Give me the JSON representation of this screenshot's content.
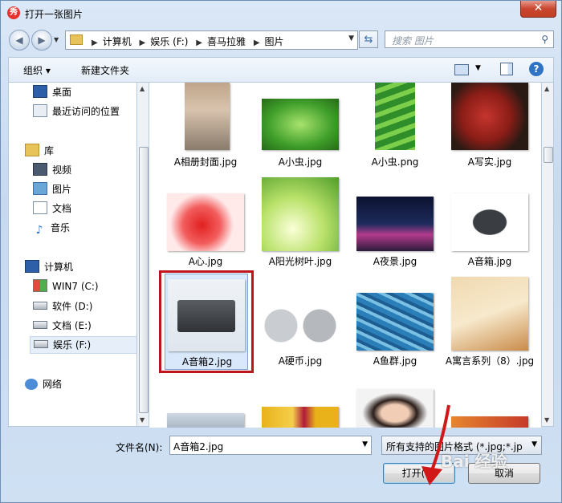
{
  "window": {
    "title": "打开一张图片",
    "close_label": "✕"
  },
  "nav": {
    "breadcrumbs": [
      "计算机",
      "娱乐 (F:)",
      "喜马拉雅",
      "图片"
    ],
    "search_placeholder": "搜索 图片"
  },
  "toolbar": {
    "organize": "组织 ▾",
    "new_folder": "新建文件夹",
    "help": "?"
  },
  "sidebar": {
    "items": [
      {
        "label": "桌面",
        "icon": "desktop-icon"
      },
      {
        "label": "最近访问的位置",
        "icon": "recent-places-icon"
      },
      {
        "label": "库",
        "icon": "library-icon"
      },
      {
        "label": "视频",
        "icon": "video-icon"
      },
      {
        "label": "图片",
        "icon": "pictures-icon"
      },
      {
        "label": "文档",
        "icon": "documents-icon"
      },
      {
        "label": "音乐",
        "icon": "music-icon"
      },
      {
        "label": "计算机",
        "icon": "computer-icon"
      },
      {
        "label": "WIN7 (C:)",
        "icon": "drive-c-icon"
      },
      {
        "label": "软件 (D:)",
        "icon": "drive-icon"
      },
      {
        "label": "文档 (E:)",
        "icon": "drive-icon"
      },
      {
        "label": "娱乐 (F:)",
        "icon": "drive-icon"
      },
      {
        "label": "网络",
        "icon": "network-icon"
      }
    ]
  },
  "files": [
    {
      "name": "A相册封面.jpg"
    },
    {
      "name": "A小虫.jpg"
    },
    {
      "name": "A小虫.png"
    },
    {
      "name": "A写实.jpg"
    },
    {
      "name": "A心.jpg"
    },
    {
      "name": "A阳光树叶.jpg"
    },
    {
      "name": "A夜景.jpg"
    },
    {
      "name": "A音箱.jpg"
    },
    {
      "name": "A音箱2.jpg"
    },
    {
      "name": "A硬币.jpg"
    },
    {
      "name": "A鱼群.jpg"
    },
    {
      "name": "A寓言系列（8）.jpg"
    }
  ],
  "bottom": {
    "filename_label": "文件名(N):",
    "filename_value": "A音箱2.jpg",
    "filter_value": "所有支持的图片格式 (*.jpg;*.jp",
    "open_button": "打开(O)",
    "cancel_button": "取消"
  },
  "watermark": "Bai 经验",
  "colors": {
    "highlight": "#c0141c",
    "selection": "#d9e8fb",
    "accent": "#2f73c5"
  }
}
